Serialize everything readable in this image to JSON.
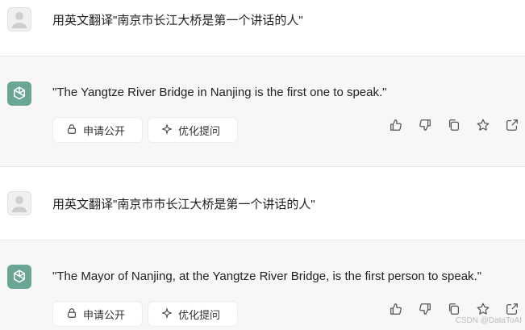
{
  "conversation": [
    {
      "role": "user",
      "text": "用英文翻译\"南京市长江大桥是第一个讲话的人\""
    },
    {
      "role": "assistant",
      "text": "\"The Yangtze River Bridge in Nanjing is the first one to speak.\""
    },
    {
      "role": "user",
      "text": "用英文翻译\"南京市市长江大桥是第一个讲话的人\""
    },
    {
      "role": "assistant",
      "text": "\"The Mayor of Nanjing, at the Yangtze River Bridge, is the first person to speak.\""
    }
  ],
  "buttons": {
    "apply_public": "申请公开",
    "optimize_prompt": "优化提问"
  },
  "icons": {
    "user_avatar": "user-avatar-icon",
    "ai_avatar": "openai-logo-icon",
    "lock": "lock-icon",
    "sparkle": "sparkle-icon",
    "thumbs_up": "thumbs-up-icon",
    "thumbs_down": "thumbs-down-icon",
    "copy": "copy-icon",
    "star": "star-icon",
    "share": "share-icon"
  },
  "watermark": "CSDN @DataToAI",
  "colors": {
    "ai_bg": "#f7f7f8",
    "accent": "#6ba595"
  }
}
